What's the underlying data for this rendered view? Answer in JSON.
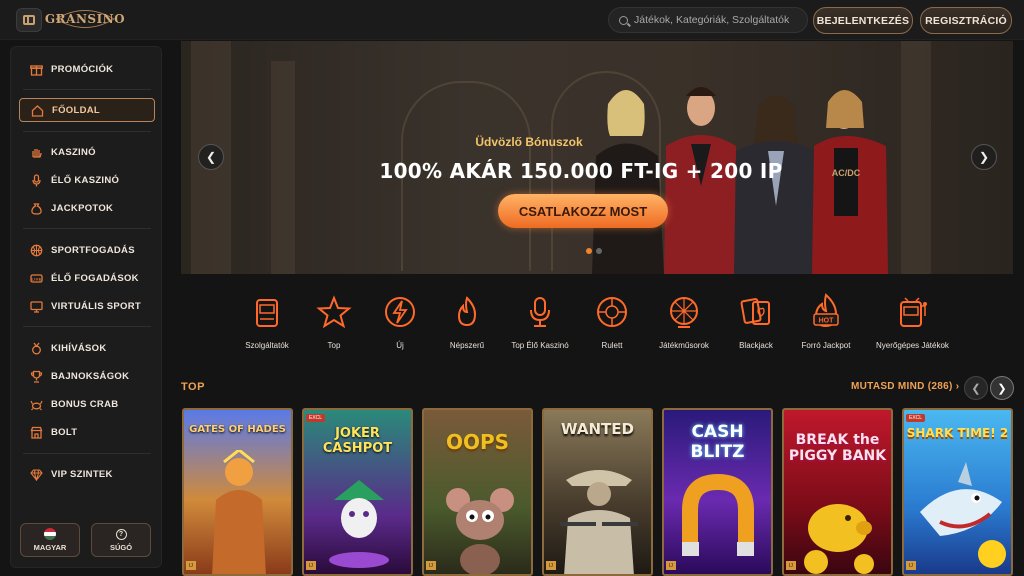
{
  "header": {
    "logo": "GRANSINO",
    "search_placeholder": "Játékok, Kategóriák, Szolgáltatók",
    "login_label": "BEJELENTKEZÉS",
    "register_label": "REGISZTRÁCIÓ"
  },
  "sidebar": {
    "items": [
      {
        "label": "PROMÓCIÓK",
        "icon": "gift-icon"
      },
      {
        "label": "FŐOLDAL",
        "icon": "home-icon",
        "active": true
      },
      {
        "label": "KASZINÓ",
        "icon": "hand-icon"
      },
      {
        "label": "ÉLŐ KASZINÓ",
        "icon": "microphone-icon"
      },
      {
        "label": "JACKPOTOK",
        "icon": "money-bag-icon"
      },
      {
        "label": "SPORTFOGADÁS",
        "icon": "basketball-icon"
      },
      {
        "label": "ÉLŐ FOGADÁSOK",
        "icon": "live-icon"
      },
      {
        "label": "VIRTUÁLIS SPORT",
        "icon": "monitor-icon"
      },
      {
        "label": "KIHÍVÁSOK",
        "icon": "medal-icon"
      },
      {
        "label": "BAJNOKSÁGOK",
        "icon": "trophy-icon"
      },
      {
        "label": "BONUS CRAB",
        "icon": "crab-icon"
      },
      {
        "label": "BOLT",
        "icon": "shop-icon"
      },
      {
        "label": "VIP SZINTEK",
        "icon": "diamond-icon"
      }
    ],
    "language_label": "MAGYAR",
    "help_label": "SÚGÓ"
  },
  "hero": {
    "subtitle": "Üdvözlő Bónuszok",
    "title": "100% AKÁR 150.000 FT-IG + 200 IP",
    "cta": "CSATLAKOZZ MOST",
    "active_slide": 1,
    "slide_count": 2
  },
  "categories": [
    {
      "label": "Szolgáltatók",
      "icon": "slot-machine-icon"
    },
    {
      "label": "Top",
      "icon": "star-icon"
    },
    {
      "label": "Új",
      "icon": "lightning-icon"
    },
    {
      "label": "Népszerű",
      "icon": "flame-icon"
    },
    {
      "label": "Top Élő Kaszinó",
      "icon": "microphone-icon"
    },
    {
      "label": "Rulett",
      "icon": "roulette-icon"
    },
    {
      "label": "Játékműsorok",
      "icon": "wheel-icon"
    },
    {
      "label": "Blackjack",
      "icon": "cards-icon"
    },
    {
      "label": "Forró Jackpot",
      "icon": "hot-jackpot-icon"
    },
    {
      "label": "Nyerőgépes Játékok",
      "icon": "slot-icon"
    }
  ],
  "section": {
    "title": "TOP",
    "show_all": "MUTASD MIND (286)"
  },
  "games": [
    {
      "name": "GATES OF HADES",
      "colors": [
        "#4a6fd8",
        "#c1702a"
      ]
    },
    {
      "name": "JOKER CASHPOT",
      "colors": [
        "#2c6e63",
        "#7a2a9a"
      ]
    },
    {
      "name": "OOPS",
      "colors": [
        "#6a4a2c",
        "#3a5a2c"
      ]
    },
    {
      "name": "WANTED",
      "colors": [
        "#6a5a42",
        "#2e2820"
      ]
    },
    {
      "name": "CASH BLITZ",
      "colors": [
        "#3a1a8a",
        "#a03ad0"
      ]
    },
    {
      "name": "BREAK the PIGGY BANK",
      "colors": [
        "#b3162a",
        "#5a0a12"
      ]
    },
    {
      "name": "SHARK TIME! 2",
      "colors": [
        "#3aaee8",
        "#1a5aa0"
      ]
    }
  ]
}
